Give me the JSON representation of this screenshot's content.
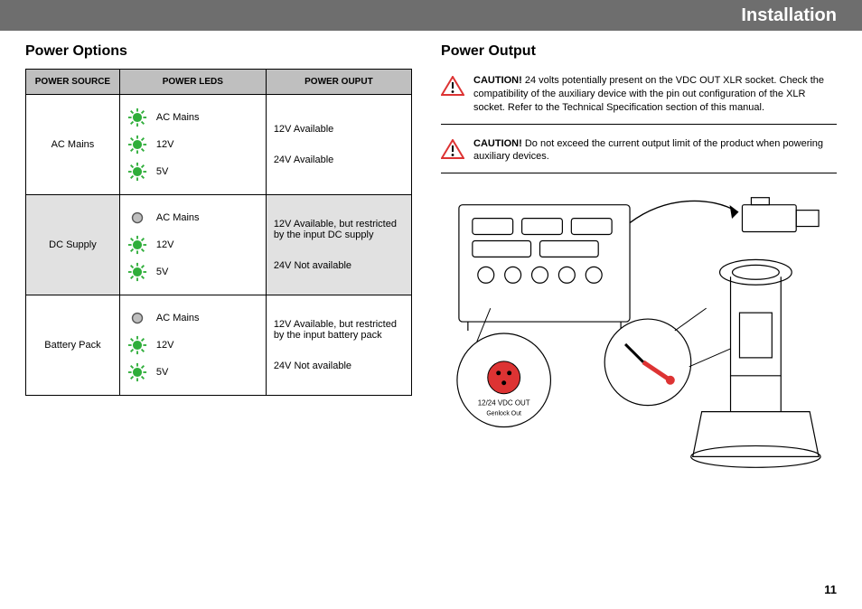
{
  "header": {
    "title": "Installation"
  },
  "page_number": "11",
  "left": {
    "heading": "Power Options",
    "table": {
      "headers": [
        "POWER SOURCE",
        "POWER LEDS",
        "POWER OUPUT"
      ],
      "rows": [
        {
          "source": "AC Mains",
          "leds": [
            {
              "label": "AC Mains",
              "state": "on"
            },
            {
              "label": "12V",
              "state": "on"
            },
            {
              "label": "5V",
              "state": "on"
            }
          ],
          "outputs": [
            "12V Available",
            "24V Available"
          ],
          "shade": false
        },
        {
          "source": "DC Supply",
          "leds": [
            {
              "label": "AC Mains",
              "state": "off"
            },
            {
              "label": "12V",
              "state": "on"
            },
            {
              "label": "5V",
              "state": "on"
            }
          ],
          "outputs": [
            "12V Available, but restricted by the input DC supply",
            "24V Not available"
          ],
          "shade": true
        },
        {
          "source": "Battery Pack",
          "leds": [
            {
              "label": "AC Mains",
              "state": "off"
            },
            {
              "label": "12V",
              "state": "on"
            },
            {
              "label": "5V",
              "state": "on"
            }
          ],
          "outputs": [
            "12V Available, but restricted by the input battery pack",
            "24V Not available"
          ],
          "shade": false
        }
      ]
    }
  },
  "right": {
    "heading": "Power Output",
    "cautions": [
      {
        "bold": "CAUTION!",
        "text": " 24 volts potentially present on the VDC OUT XLR socket. Check the compatibility of the auxiliary device with the pin out configuration of the XLR socket. Refer to the Technical Specification section of this manual."
      },
      {
        "bold": "CAUTION!",
        "text": " Do not exceed the current output limit of the product when powering auxiliary devices."
      }
    ],
    "illustration_labels": {
      "vdc_out": "12/24 VDC OUT",
      "genlock": "Genlock Out"
    }
  }
}
